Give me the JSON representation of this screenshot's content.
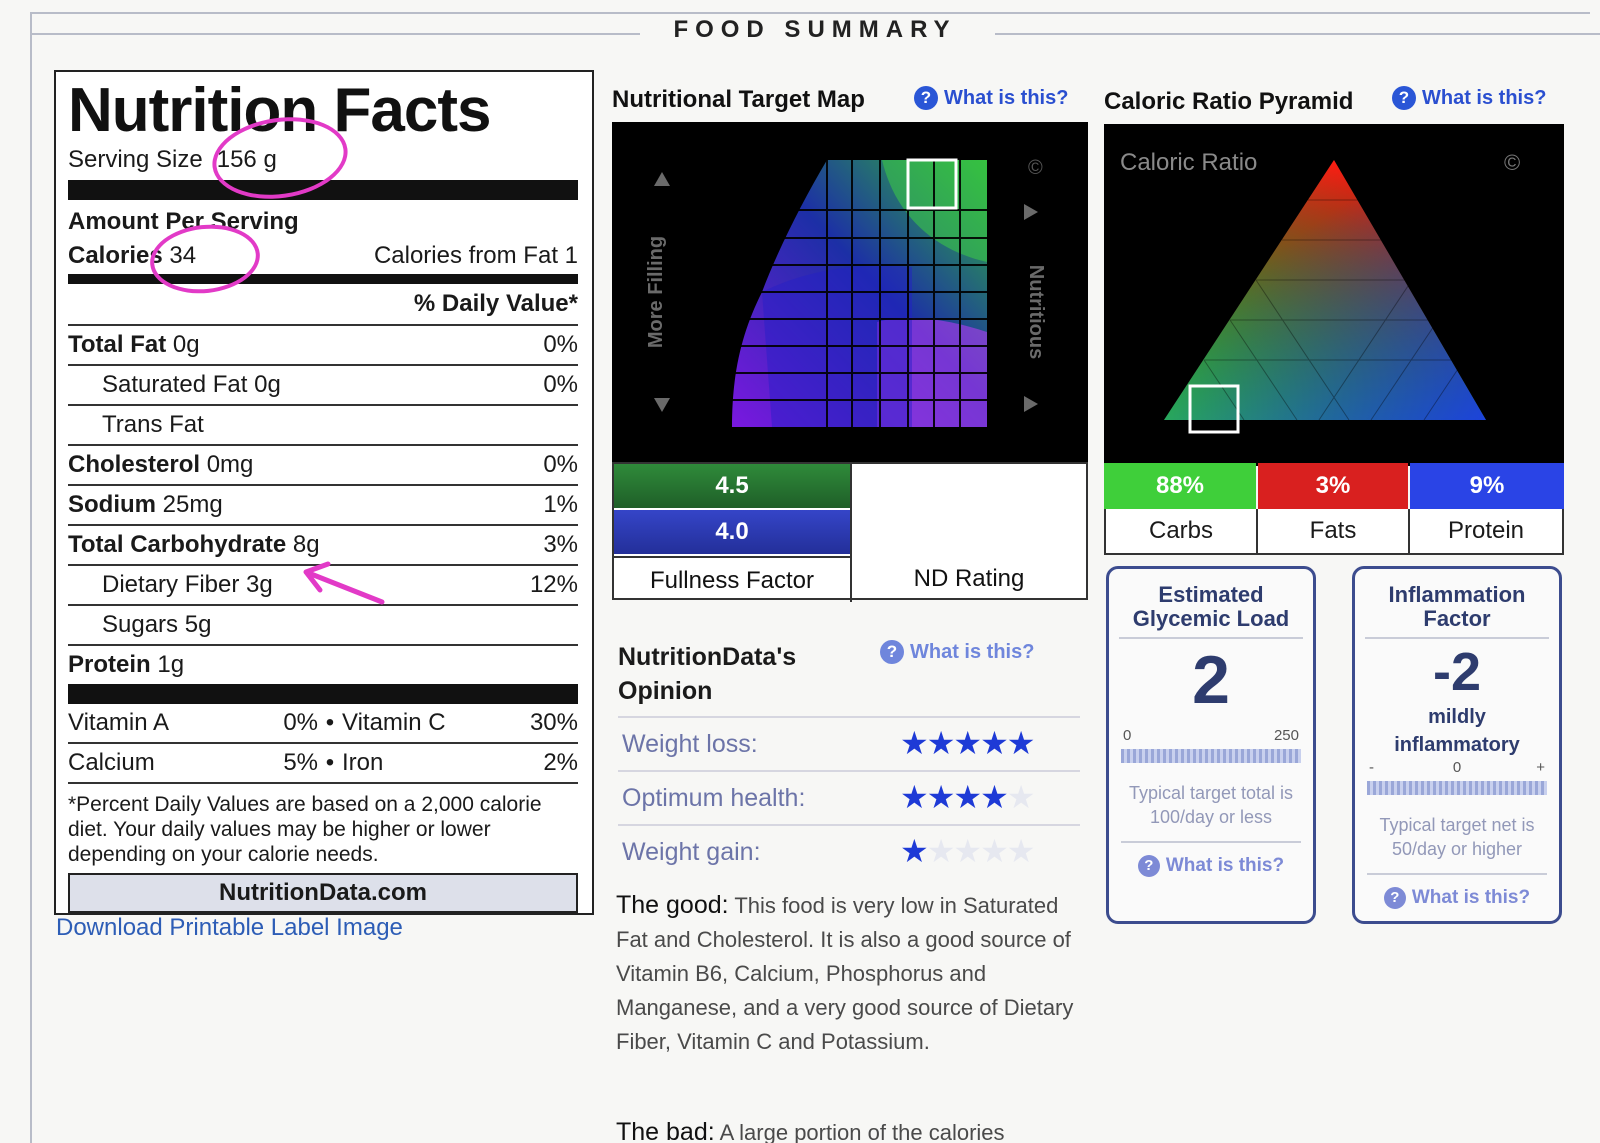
{
  "header": {
    "title": "FOOD SUMMARY"
  },
  "label": {
    "title": "Nutrition Facts",
    "serving_size_label": "Serving Size",
    "serving_size_value": "156 g",
    "amount_per_serving": "Amount Per Serving",
    "calories_label": "Calories",
    "calories_value": "34",
    "calories_from_fat": "Calories from Fat 1",
    "daily_value_header": "% Daily Value*",
    "nutrients": [
      {
        "name": "Total Fat",
        "amount": "0g",
        "dv": "0%"
      },
      {
        "name": "Saturated Fat",
        "amount": "0g",
        "dv": "0%"
      },
      {
        "name": "Trans Fat",
        "amount": "",
        "dv": ""
      },
      {
        "name": "Cholesterol",
        "amount": "0mg",
        "dv": "0%"
      },
      {
        "name": "Sodium",
        "amount": "25mg",
        "dv": "1%"
      },
      {
        "name": "Total Carbohydrate",
        "amount": "8g",
        "dv": "3%"
      },
      {
        "name": "Dietary Fiber",
        "amount": "3g",
        "dv": "12%"
      },
      {
        "name": "Sugars",
        "amount": "5g",
        "dv": ""
      },
      {
        "name": "Protein",
        "amount": "1g",
        "dv": ""
      }
    ],
    "vitamins": [
      {
        "a_name": "Vitamin A",
        "a_dv": "0%",
        "b_name": "Vitamin C",
        "b_dv": "30%"
      },
      {
        "a_name": "Calcium",
        "a_dv": "5%",
        "b_name": "Iron",
        "b_dv": "2%"
      }
    ],
    "bullet": "•",
    "footnote": "*Percent Daily Values are based on a 2,000 calorie diet. Your daily values may be higher or lower depending on your calorie needs.",
    "brand": "NutritionData.com"
  },
  "download_link": "Download Printable Label Image",
  "target_map": {
    "title": "Nutritional Target Map",
    "help": "What is this?",
    "help_glyph": "?",
    "axis_left": "More Filling",
    "axis_right": "Nutritious",
    "copyright": "©",
    "fullness_score": "4.5",
    "nd_score": "4.0",
    "fullness_label": "Fullness Factor",
    "nd_label": "ND Rating"
  },
  "pyramid": {
    "title": "Caloric Ratio Pyramid",
    "help": "What is this?",
    "chart_label": "Caloric Ratio",
    "copyright": "©",
    "ratios": [
      {
        "label": "Carbs",
        "value": "88%",
        "color": "#3fcf3a"
      },
      {
        "label": "Fats",
        "value": "3%",
        "color": "#d9201f"
      },
      {
        "label": "Protein",
        "value": "9%",
        "color": "#2a44e6"
      }
    ]
  },
  "opinion": {
    "title_line1": "NutritionData's",
    "title_line2": "Opinion",
    "help": "What is this?",
    "rows": [
      {
        "label": "Weight loss:",
        "stars": 5
      },
      {
        "label": "Optimum health:",
        "stars": 4
      },
      {
        "label": "Weight gain:",
        "stars": 1
      }
    ],
    "good_label": "The good:",
    "good_text": "This food is very low in Saturated Fat and Cholesterol. It is also a good source of Vitamin B6, Calcium, Phosphorus and Manganese, and a very good source of Dietary Fiber, Vitamin C and Potassium.",
    "bad_label": "The bad:",
    "bad_text": "A large portion of the calories"
  },
  "glycemic": {
    "title_line1": "Estimated",
    "title_line2": "Glycemic Load",
    "value": "2",
    "scale_low": "0",
    "scale_high": "250",
    "note": "Typical target total is 100/day or less",
    "help": "What is this?"
  },
  "inflammation": {
    "title_line1": "Inflammation",
    "title_line2": "Factor",
    "value": "-2",
    "qualifier": "mildly inflammatory",
    "scale_low": "-",
    "scale_mid": "0",
    "scale_high": "+",
    "note": "Typical target net is 50/day or higher",
    "help": "What is this?"
  },
  "colors": {
    "link": "#2a4fd0",
    "annotation": "#e23ac7",
    "star": "#1e3ad6"
  }
}
